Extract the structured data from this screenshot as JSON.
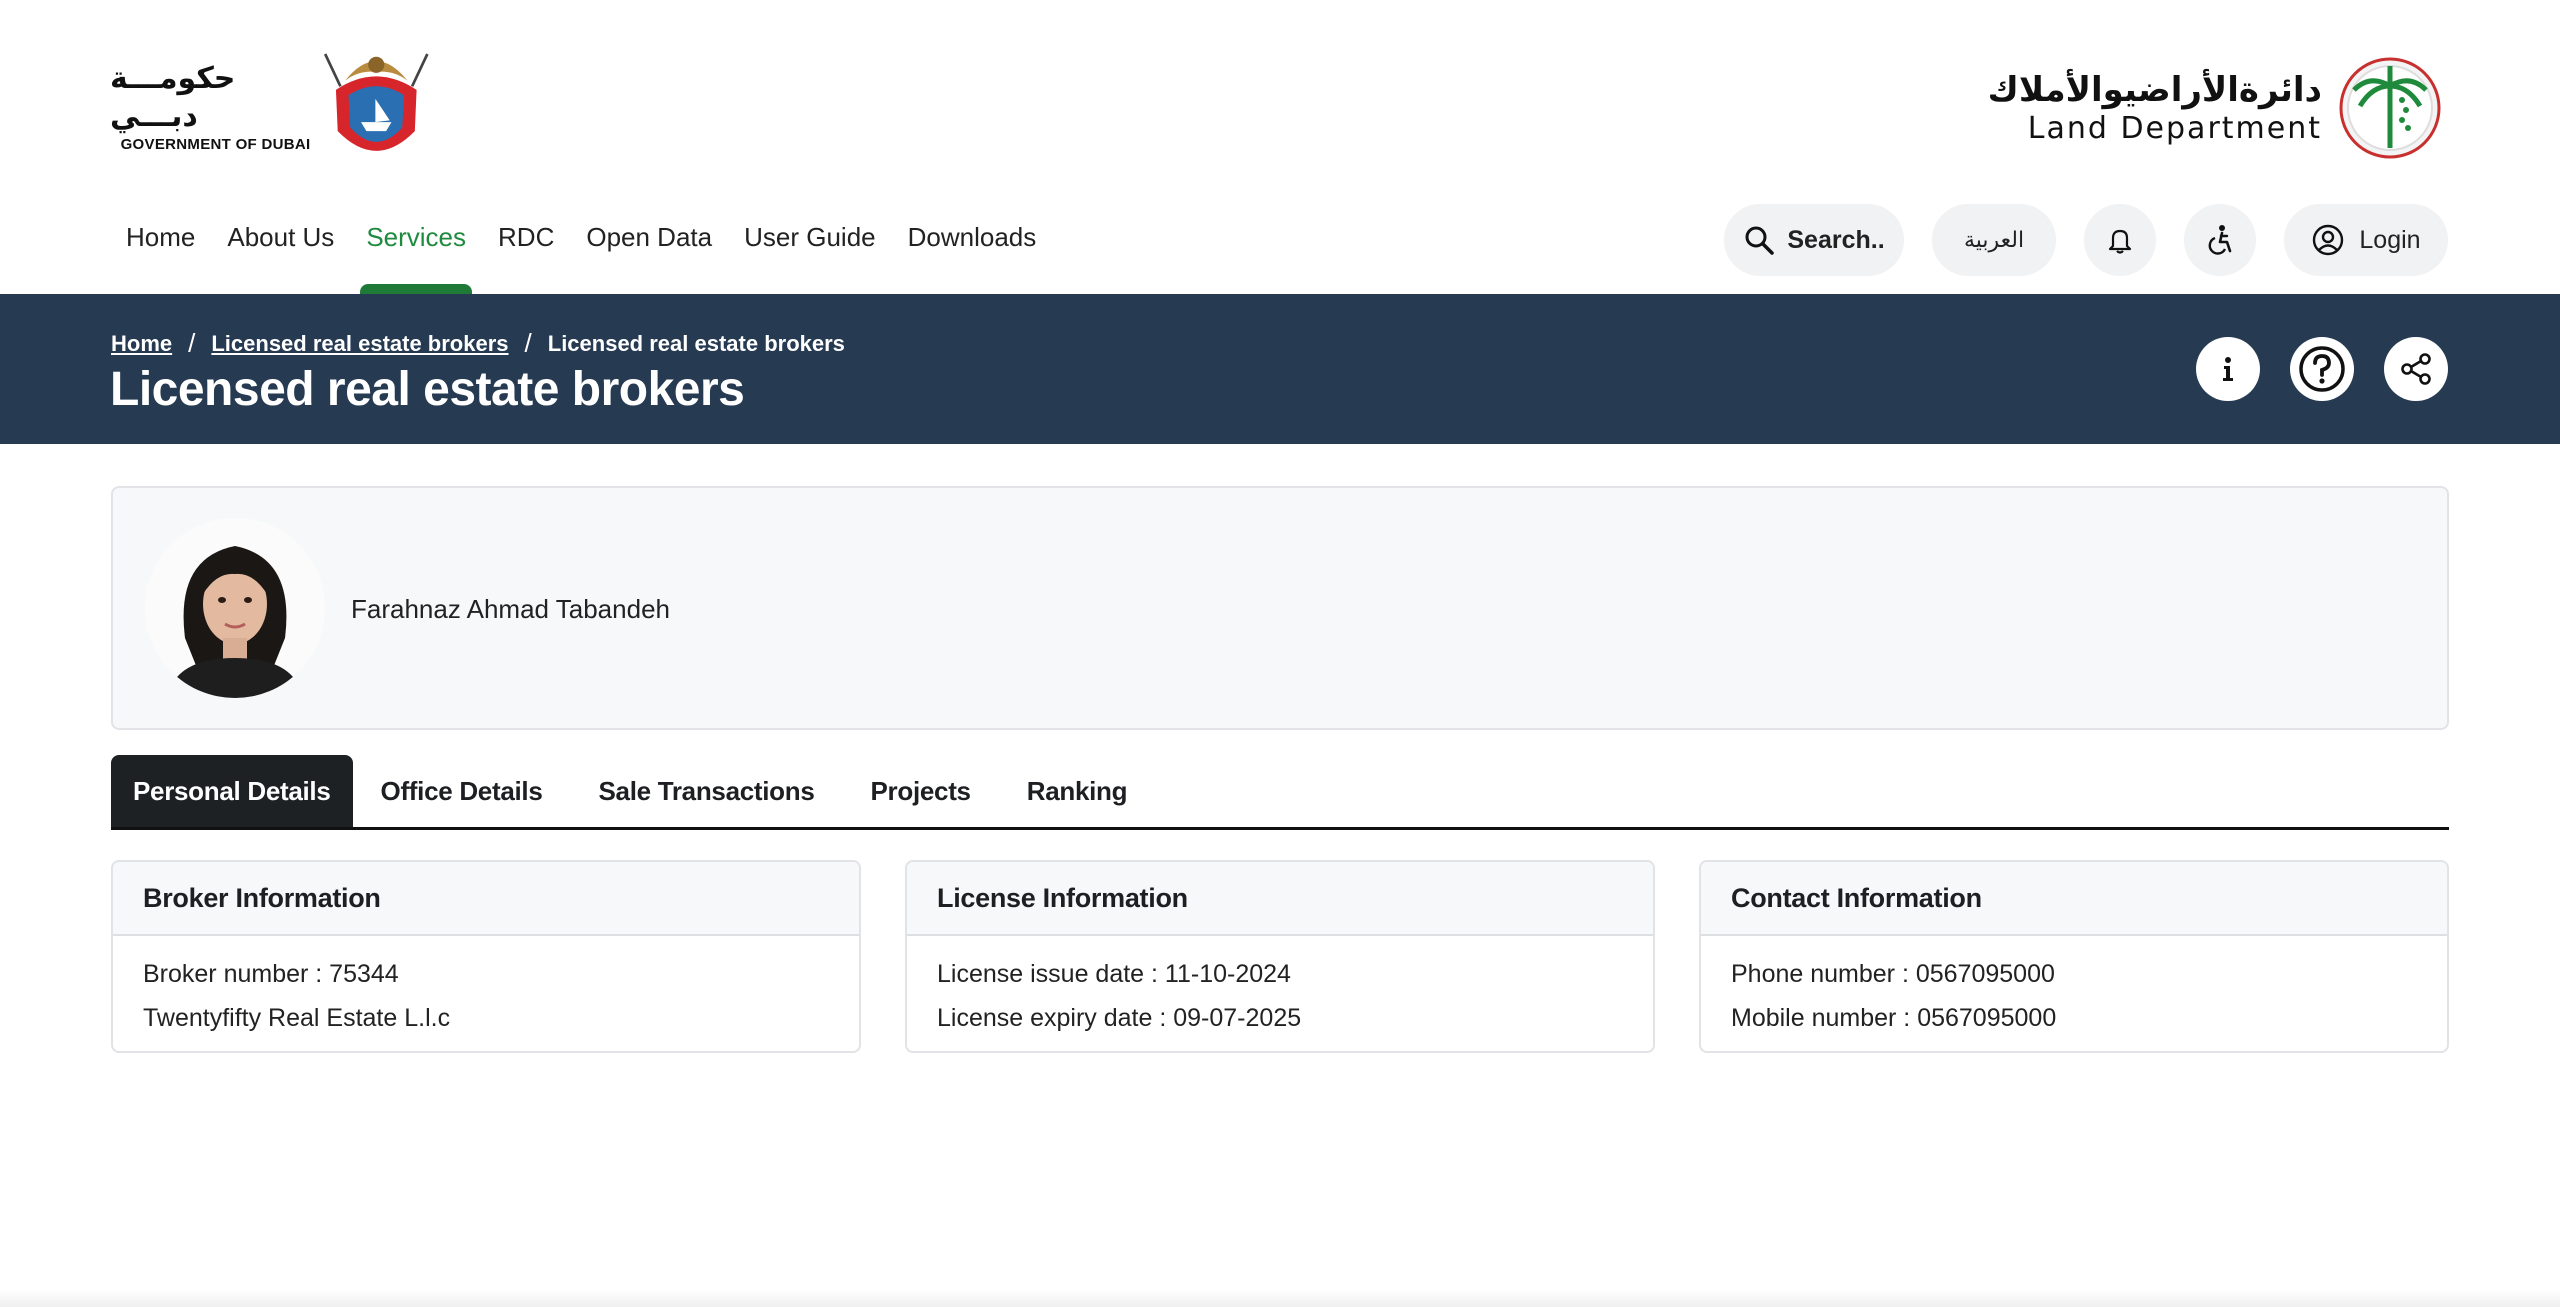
{
  "header": {
    "gov_logo": {
      "arabic": "حكومـــة دبـــي",
      "english": "GOVERNMENT OF DUBAI"
    },
    "dld_logo": {
      "arabic": "دائرةالأراضيوالأملاك",
      "english": "Land Department"
    }
  },
  "nav": {
    "items": [
      {
        "label": "Home"
      },
      {
        "label": "About Us"
      },
      {
        "label": "Services",
        "active": true
      },
      {
        "label": "RDC"
      },
      {
        "label": "Open Data"
      },
      {
        "label": "User Guide"
      },
      {
        "label": "Downloads"
      }
    ]
  },
  "actions": {
    "search_label": "Search..",
    "language_label": "العربية",
    "login_label": "Login"
  },
  "band": {
    "breadcrumb": [
      "Home",
      "Licensed real estate brokers",
      "Licensed real estate brokers"
    ],
    "breadcrumb_sep": "/",
    "title": "Licensed real estate brokers"
  },
  "profile": {
    "name": "Farahnaz Ahmad Tabandeh"
  },
  "tabs": [
    {
      "label": "Personal Details",
      "active": true
    },
    {
      "label": "Office Details"
    },
    {
      "label": "Sale Transactions"
    },
    {
      "label": "Projects"
    },
    {
      "label": "Ranking"
    }
  ],
  "cards": {
    "broker": {
      "title": "Broker Information",
      "lines": [
        "Broker number : 75344",
        "Twentyfifty Real Estate L.l.c"
      ]
    },
    "license": {
      "title": "License Information",
      "lines": [
        "License issue date : 11-10-2024",
        "License expiry date : 09-07-2025"
      ]
    },
    "contact": {
      "title": "Contact Information",
      "lines": [
        "Phone number : 0567095000",
        "Mobile number : 0567095000"
      ]
    }
  },
  "colors": {
    "accent_green": "#208a3f",
    "band_navy": "#263a52",
    "active_tab": "#1e2124"
  }
}
